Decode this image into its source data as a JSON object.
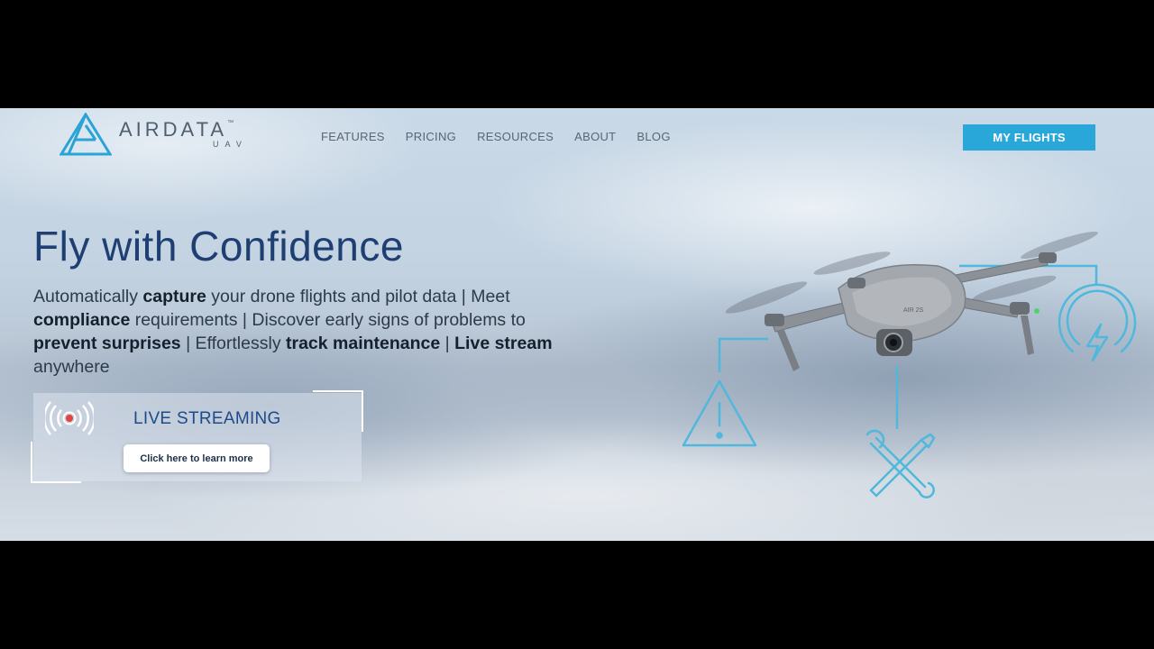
{
  "header": {
    "logo": {
      "name": "AIRDATA",
      "trademark": "™",
      "sub": "UAV"
    },
    "nav": [
      "FEATURES",
      "PRICING",
      "RESOURCES",
      "ABOUT",
      "BLOG"
    ],
    "cta_label": "MY FLIGHTS"
  },
  "hero": {
    "title": "Fly with Confidence",
    "desc": {
      "s1": "Automatically ",
      "b1": "capture",
      "s2": " your drone flights and pilot data | Meet ",
      "b2": "compliance",
      "s3": " requirements | Discover early signs of problems to ",
      "b3": "prevent surprises",
      "s4": " | Effortlessly ",
      "b4": "track maintenance",
      "s5": " | ",
      "b5": "Live stream",
      "s6": " anywhere"
    }
  },
  "live": {
    "title": "LIVE STREAMING",
    "button": "Click here to learn more"
  },
  "illustration": {
    "drone_label": "AIR 2S",
    "icons": [
      "warning-icon",
      "wrench-screwdriver-icon",
      "battery-power-icon"
    ]
  },
  "colors": {
    "accent": "#29a7d8",
    "title": "#1f3f73",
    "live_title": "#1f4a8a",
    "line_icons": "#4fb8dc"
  }
}
